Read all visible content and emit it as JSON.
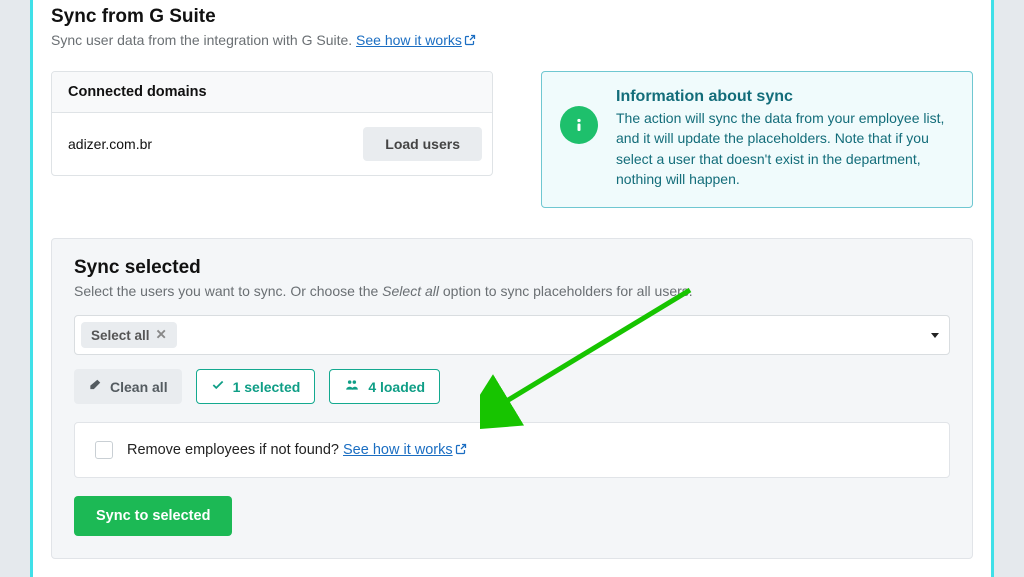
{
  "header": {
    "title": "Sync from G Suite",
    "subtitle": "Sync user data from the integration with G Suite. ",
    "how_link": "See how it works"
  },
  "domains": {
    "title": "Connected domains",
    "items": [
      {
        "name": "adizer.com.br",
        "button": "Load users"
      }
    ]
  },
  "info": {
    "title": "Information about sync",
    "body": "The action will sync the data from your employee list, and it will update the placeholders. Note that if you select a user that doesn't exist in the department, nothing will happen."
  },
  "sync": {
    "title": "Sync selected",
    "subtitle_pre": "Select the users you want to sync. Or choose the ",
    "subtitle_em": "Select all",
    "subtitle_post": " option to sync placeholders for all users.",
    "chip": "Select all",
    "clean": "Clean all",
    "selected_count": "1 selected",
    "loaded_count": "4 loaded",
    "remove_label": "Remove employees if not found? ",
    "remove_link": "See how it works",
    "submit": "Sync to selected"
  },
  "colors": {
    "accent_border": "#3fe0e8",
    "primary_green": "#1cb955",
    "info_green": "#1ec06c",
    "teal_outline": "#14a98f",
    "link_blue": "#1b6ec2"
  }
}
